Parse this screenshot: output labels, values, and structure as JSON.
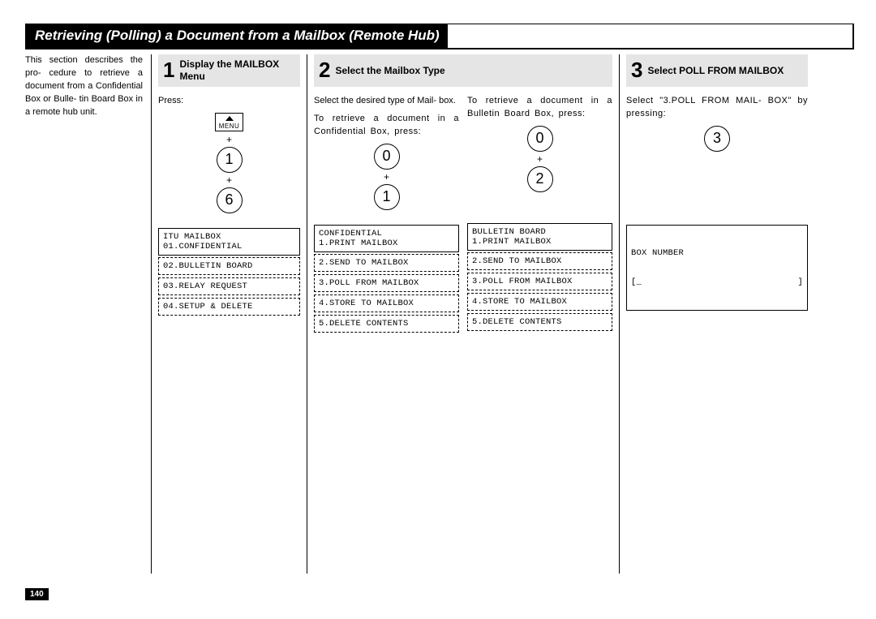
{
  "page": {
    "title": "Retrieving (Polling) a Document from a Mailbox (Remote Hub)",
    "page_number": "140"
  },
  "intro": {
    "text": "This section describes the pro- cedure to retrieve a document from a Confidential Box or Bulle- tin Board Box in a remote hub unit."
  },
  "step1": {
    "num": "1",
    "title": "Display the MAILBOX Menu",
    "press": "Press:",
    "menu_btn_label": "MENU",
    "key_a": "1",
    "key_b": "6",
    "lcd_solid": "ITU MAILBOX\n01.CONFIDENTIAL",
    "lcd_d1": "02.BULLETIN BOARD",
    "lcd_d2": "03.RELAY REQUEST",
    "lcd_d3": "04.SETUP & DELETE"
  },
  "step2": {
    "num": "2",
    "title": "Select the Mailbox Type",
    "intro": "Select the desired type of Mail- box.",
    "left": {
      "text": "To retrieve a document in a Confidential Box, press:",
      "key_a": "0",
      "key_b": "1",
      "lcd_solid": "CONFIDENTIAL\n1.PRINT MAILBOX",
      "lcd_d1": "2.SEND TO MAILBOX",
      "lcd_d2": "3.POLL FROM MAILBOX",
      "lcd_d3": "4.STORE TO MAILBOX",
      "lcd_d4": "5.DELETE CONTENTS"
    },
    "right": {
      "text": "To retrieve a document in a Bulletin Board Box, press:",
      "key_a": "0",
      "key_b": "2",
      "lcd_solid": "BULLETIN BOARD\n1.PRINT MAILBOX",
      "lcd_d1": "2.SEND TO MAILBOX",
      "lcd_d2": "3.POLL FROM MAILBOX",
      "lcd_d3": "4.STORE TO MAILBOX",
      "lcd_d4": "5.DELETE CONTENTS"
    }
  },
  "step3": {
    "num": "3",
    "title": "Select POLL FROM MAILBOX",
    "text": "Select \"3.POLL FROM MAIL- BOX\" by pressing:",
    "key": "3",
    "lcd_label": "BOX NUMBER",
    "lcd_input_left": "[_",
    "lcd_input_right": "]"
  }
}
